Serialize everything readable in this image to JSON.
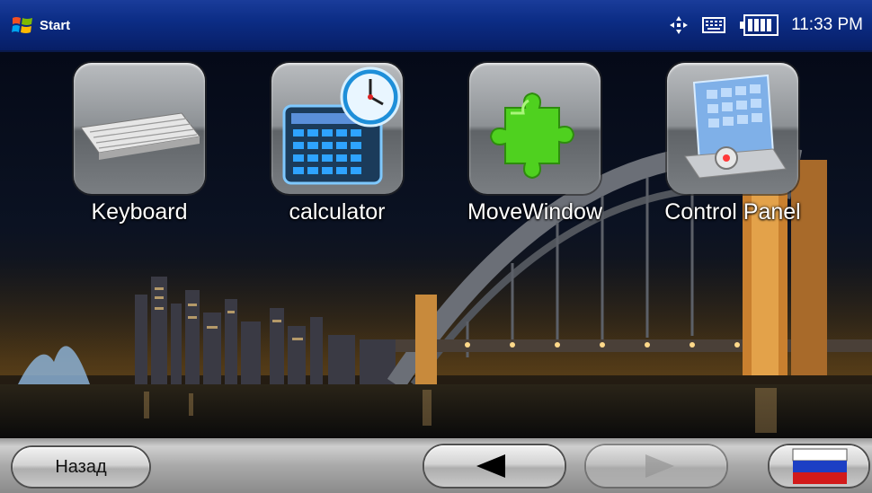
{
  "taskbar": {
    "start_label": "Start",
    "time": "11:33 PM",
    "icons": [
      "windows-flag-icon",
      "connectivity-icon",
      "input-panel-icon",
      "battery-icon"
    ]
  },
  "desktop": {
    "apps": [
      {
        "label": "Keyboard",
        "icon": "keyboard-icon"
      },
      {
        "label": "calculator",
        "icon": "calculator-icon"
      },
      {
        "label": "MoveWindow",
        "icon": "puzzle-icon"
      },
      {
        "label": "Control Panel",
        "icon": "control-panel-icon"
      }
    ]
  },
  "bottombar": {
    "back_label": "Назад",
    "prev_icon": "arrow-left-icon",
    "next_icon": "arrow-right-icon",
    "next_enabled": false,
    "language_icon": "russian-flag-icon"
  },
  "colors": {
    "taskbar": "#0c2d86",
    "puzzle": "#4fd11f",
    "clock_face": "#1e8fd9"
  }
}
